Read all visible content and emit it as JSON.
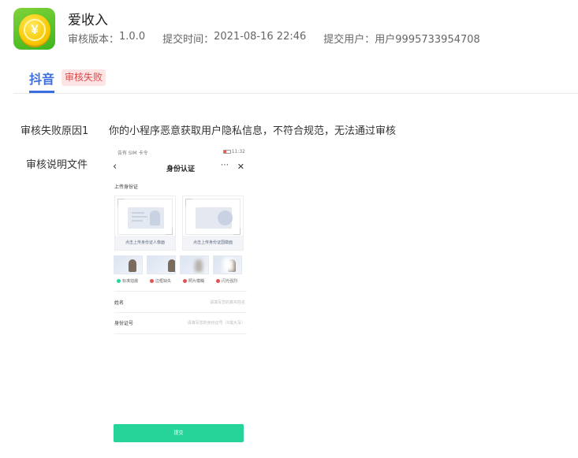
{
  "app": {
    "name": "爱收入",
    "version_label": "审核版本：",
    "version": "1.0.0",
    "submit_time_label": "提交时间：",
    "submit_time": "2021-08-16 22:46",
    "submit_user_label": "提交用户：",
    "submit_user": "用户9995733954708"
  },
  "tabs": [
    {
      "label": "抖音",
      "badge": "审核失败"
    }
  ],
  "review": {
    "reason_label": "审核失败原因1",
    "reason_text": "你的小程序恶意获取用户隐私信息，不符合规范，无法通过审核",
    "doc_label": "审核说明文件"
  },
  "phone": {
    "status_left": "告有 SIM 卡令",
    "status_time": "11:32",
    "nav_title": "身份认证",
    "more_icon": "⋯",
    "close_icon": "✕",
    "back_icon": "‹",
    "upload_title": "上传身份证",
    "front_caption": "点击上传身份证人像面",
    "back_caption": "点击上传身份证国徽面",
    "samples": [
      {
        "label": "标准拍摄",
        "color": "#26d49a"
      },
      {
        "label": "边框缺失",
        "color": "#e05454"
      },
      {
        "label": "照片模糊",
        "color": "#e05454"
      },
      {
        "label": "闪光强烈",
        "color": "#e05454"
      }
    ],
    "name_label": "姓名",
    "name_placeholder": "请填写您的真实姓名",
    "id_label": "身份证号",
    "id_placeholder": "请填写您的身份证号（X需大写）",
    "submit_label": "提交"
  }
}
